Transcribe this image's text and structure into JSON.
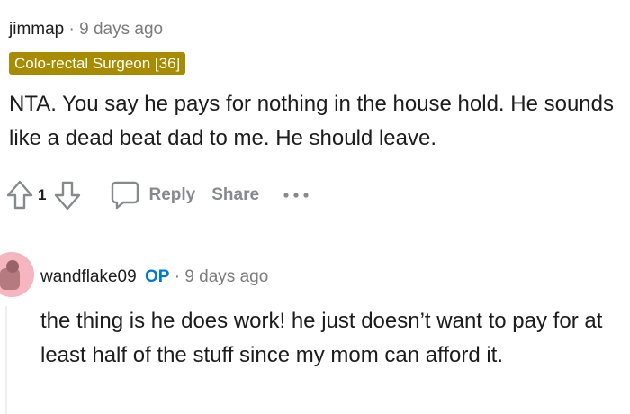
{
  "comment1": {
    "author": "jimmap",
    "separator": "·",
    "time": "9 days ago",
    "flair": "Colo-rectal Surgeon [36]",
    "body": "NTA. You say he pays for nothing in the house hold. He sounds like a dead beat dad to me. He should leave.",
    "score": "1",
    "reply_label": "Reply",
    "share_label": "Share"
  },
  "comment2": {
    "author": "wandflake09",
    "op_badge": "OP",
    "separator": "·",
    "time": "9 days ago",
    "body": "the thing is he does work! he just doesn’t want to pay for at least half of the stuff since my mom can afford it."
  },
  "colors": {
    "flair_bg": "#a88b00",
    "op_blue": "#0079d3",
    "muted": "#878a8c",
    "avatar_bg": "#f6b6bf"
  },
  "icons": [
    "upvote-icon",
    "downvote-icon",
    "comment-bubble-icon",
    "more-dots-icon",
    "avatar-icon"
  ]
}
